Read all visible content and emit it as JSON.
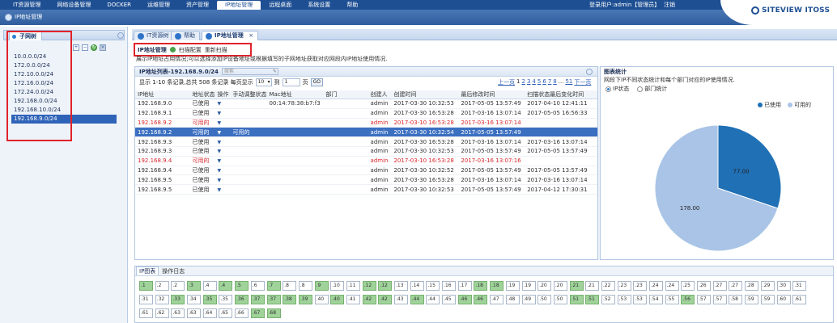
{
  "topnav": {
    "menu": [
      "IT资源管理",
      "网络设备管理",
      "DOCKER",
      "运维管理",
      "资产管理",
      "IP地址管理",
      "远程桌面",
      "系统设置",
      "帮助"
    ],
    "active_index": 5,
    "user_text": "登录用户:admin【管理员】",
    "logout": "注销"
  },
  "banner": {
    "breadcrumb": "IP地址管理",
    "logo_text": "SITEVIEW ITOSS"
  },
  "left": {
    "tab_label": "子网树",
    "tree": [
      "10.0.0.0/24",
      "172.0.0.0/24",
      "172.10.0.0/24",
      "172.16.0.0/24",
      "172.24.0.0/24",
      "192.168.0.0/24",
      "192.168.10.0/24",
      "192.168.9.0/24"
    ],
    "selected_index": 7
  },
  "tabs": [
    {
      "label": "IT资源树"
    },
    {
      "label": "帮助"
    },
    {
      "label": "IP地址管理",
      "close": "×"
    }
  ],
  "toolbar": {
    "title": "IP地址管理",
    "scan": "扫描配置",
    "rescan": "重新扫描"
  },
  "description": "展示IP地址占用情况;可以选择添加IP设备地址或根据填写的子网地址获取对应网段内IP地址使用情况.",
  "list": {
    "title": "IP地址列表-192.168.9.0/24",
    "search_placeholder": "搜索",
    "records": "显示 1-10 条记录,总共 508 条记录 每页显示",
    "page_size": "10",
    "goto_label": "到",
    "page_input": "1",
    "page_suffix": "页",
    "go": "GO",
    "pages": [
      "上一页",
      "1",
      "2",
      "3",
      "4",
      "5",
      "6",
      "7",
      "8",
      "...",
      "51",
      "下一页"
    ],
    "columns": [
      "IP地址",
      "地址状态",
      "操作",
      "手动调整状态",
      "Mac地址",
      "部门",
      "创建人",
      "创建时间",
      "最后修改时间",
      "扫描状态最后变化时间"
    ],
    "rows": [
      {
        "ip": "192.168.9.0",
        "status": "已使用",
        "mark": "▼",
        "manual": "",
        "mac": "00:14:78:38:b7:f3",
        "dept": "",
        "creator": "admin",
        "created": "2017-03-30 10:32:53",
        "modified": "2017-05-05 13:57:49",
        "scan": "2017-04-10 12:41:11",
        "style": "normal"
      },
      {
        "ip": "192.168.9.1",
        "status": "已使用",
        "mark": "▼",
        "manual": "",
        "mac": "",
        "dept": "",
        "creator": "admin",
        "created": "2017-03-30 16:53:28",
        "modified": "2017-03-16 13:07:14",
        "scan": "2017-05-05 16:56:33",
        "style": "normal"
      },
      {
        "ip": "192.168.9.2",
        "status": "可用的",
        "mark": "▼",
        "manual": "",
        "mac": "",
        "dept": "",
        "creator": "admin",
        "created": "2017-03-10 16:53:28",
        "modified": "2017-03-16 13:07:14",
        "scan": "",
        "style": "red"
      },
      {
        "ip": "192.168.9.2",
        "status": "可用的",
        "mark": "▼",
        "manual": "可用的",
        "mac": "",
        "dept": "",
        "creator": "admin",
        "created": "2017-03-30 10:32:54",
        "modified": "2017-05-05 13:57:49",
        "scan": "",
        "style": "selected"
      },
      {
        "ip": "192.168.9.3",
        "status": "已使用",
        "mark": "▼",
        "manual": "",
        "mac": "",
        "dept": "",
        "creator": "admin",
        "created": "2017-03-30 16:53:28",
        "modified": "2017-03-16 13:07:14",
        "scan": "2017-03-16 13:07:14",
        "style": "normal"
      },
      {
        "ip": "192.168.9.3",
        "status": "已使用",
        "mark": "▼",
        "manual": "",
        "mac": "",
        "dept": "",
        "creator": "admin",
        "created": "2017-03-30 10:32:53",
        "modified": "2017-05-05 13:57:49",
        "scan": "2017-05-05 13:57:49",
        "style": "normal"
      },
      {
        "ip": "192.168.9.4",
        "status": "可用的",
        "mark": "▼",
        "manual": "",
        "mac": "",
        "dept": "",
        "creator": "admin",
        "created": "2017-03-10 16:53:28",
        "modified": "2017-03-16 13:07:16",
        "scan": "",
        "style": "red"
      },
      {
        "ip": "192.168.9.4",
        "status": "已使用",
        "mark": "▼",
        "manual": "",
        "mac": "",
        "dept": "",
        "creator": "admin",
        "created": "2017-03-30 10:32:52",
        "modified": "2017-05-05 13:57:49",
        "scan": "2017-05-05 13:57:49",
        "style": "normal"
      },
      {
        "ip": "192.168.9.5",
        "status": "已使用",
        "mark": "▼",
        "manual": "",
        "mac": "",
        "dept": "",
        "creator": "admin",
        "created": "2017-03-30 16:53:28",
        "modified": "2017-03-16 13:07:14",
        "scan": "2017-03-16 13:07:14",
        "style": "normal"
      },
      {
        "ip": "192.168.9.5",
        "status": "已使用",
        "mark": "▼",
        "manual": "",
        "mac": "",
        "dept": "",
        "creator": "admin",
        "created": "2017-03-30 10:32:53",
        "modified": "2017-05-05 13:57:49",
        "scan": "2017-04-12 17:30:31",
        "style": "normal"
      }
    ]
  },
  "chart_panel": {
    "title": "图表统计",
    "desc": "网段下IP不同状态统计和每个部门对应的IP使用情况.",
    "radio_status": "IP状态",
    "radio_dept": "部门统计"
  },
  "chart_data": {
    "type": "pie",
    "title": "",
    "legend_position": "top-right",
    "slices": [
      {
        "name": "已使用",
        "value": 77.0,
        "label": "77.00",
        "color": "#2070b5"
      },
      {
        "name": "可用的",
        "value": 178.0,
        "label": "178.00",
        "color": "#a9c4e6"
      }
    ]
  },
  "bottom": {
    "tabs": [
      "IP图表",
      "操作日志"
    ],
    "active_tab": 0,
    "cells": [
      {
        "n": ".1",
        "u": 1
      },
      {
        "n": ".2",
        "u": 0
      },
      {
        "n": ".2",
        "u": 0
      },
      {
        "n": ".3",
        "u": 1
      },
      {
        "n": ".4",
        "u": 0
      },
      {
        "n": ".4",
        "u": 1
      },
      {
        "n": ".5",
        "u": 1
      },
      {
        "n": ".6",
        "u": 0
      },
      {
        "n": ".7",
        "u": 1
      },
      {
        "n": ".8",
        "u": 0
      },
      {
        "n": ".8",
        "u": 0
      },
      {
        "n": ".9",
        "u": 1
      },
      {
        "n": ".10",
        "u": 0
      },
      {
        "n": ".11",
        "u": 0
      },
      {
        "n": ".12",
        "u": 1
      },
      {
        "n": ".12",
        "u": 1
      },
      {
        "n": ".13",
        "u": 0
      },
      {
        "n": ".14",
        "u": 0
      },
      {
        "n": ".15",
        "u": 0
      },
      {
        "n": ".16",
        "u": 0
      },
      {
        "n": ".17",
        "u": 0
      },
      {
        "n": ".18",
        "u": 1
      },
      {
        "n": ".18",
        "u": 1
      },
      {
        "n": ".19",
        "u": 0
      },
      {
        "n": ".19",
        "u": 0
      },
      {
        "n": ".20",
        "u": 0
      },
      {
        "n": ".20",
        "u": 0
      },
      {
        "n": ".21",
        "u": 1
      },
      {
        "n": ".21",
        "u": 0
      },
      {
        "n": ".22",
        "u": 0
      },
      {
        "n": ".23",
        "u": 0
      },
      {
        "n": ".23",
        "u": 0
      },
      {
        "n": ".24",
        "u": 0
      },
      {
        "n": ".24",
        "u": 0
      },
      {
        "n": ".25",
        "u": 0
      },
      {
        "n": ".26",
        "u": 0
      },
      {
        "n": ".27",
        "u": 0
      },
      {
        "n": ".27",
        "u": 0
      },
      {
        "n": ".28",
        "u": 0
      },
      {
        "n": ".29",
        "u": 0
      },
      {
        "n": ".30",
        "u": 0
      },
      {
        "n": ".31",
        "u": 0
      },
      {
        "n": ".31",
        "u": 0
      },
      {
        "n": ".32",
        "u": 0
      },
      {
        "n": ".33",
        "u": 1
      },
      {
        "n": ".34",
        "u": 0
      },
      {
        "n": ".35",
        "u": 1
      },
      {
        "n": ".35",
        "u": 0
      },
      {
        "n": ".36",
        "u": 1
      },
      {
        "n": ".37",
        "u": 1
      },
      {
        "n": ".37",
        "u": 1
      },
      {
        "n": ".38",
        "u": 1
      },
      {
        "n": ".39",
        "u": 1
      },
      {
        "n": ".40",
        "u": 0
      },
      {
        "n": ".40",
        "u": 1
      },
      {
        "n": ".41",
        "u": 0
      },
      {
        "n": ".42",
        "u": 1
      },
      {
        "n": ".42",
        "u": 1
      },
      {
        "n": ".43",
        "u": 0
      },
      {
        "n": ".44",
        "u": 1
      },
      {
        "n": ".44",
        "u": 0
      },
      {
        "n": ".45",
        "u": 0
      },
      {
        "n": ".46",
        "u": 1
      },
      {
        "n": ".46",
        "u": 1
      },
      {
        "n": ".47",
        "u": 0
      },
      {
        "n": ".48",
        "u": 0
      },
      {
        "n": ".49",
        "u": 0
      },
      {
        "n": ".50",
        "u": 0
      },
      {
        "n": ".50",
        "u": 0
      },
      {
        "n": ".51",
        "u": 1
      },
      {
        "n": ".51",
        "u": 1
      },
      {
        "n": ".52",
        "u": 0
      },
      {
        "n": ".53",
        "u": 0
      },
      {
        "n": ".53",
        "u": 0
      },
      {
        "n": ".54",
        "u": 0
      },
      {
        "n": ".55",
        "u": 0
      },
      {
        "n": ".56",
        "u": 1
      },
      {
        "n": ".57",
        "u": 0
      },
      {
        "n": ".57",
        "u": 0
      },
      {
        "n": ".58",
        "u": 0
      },
      {
        "n": ".59",
        "u": 0
      },
      {
        "n": ".59",
        "u": 0
      },
      {
        "n": ".60",
        "u": 0
      },
      {
        "n": ".61",
        "u": 0
      },
      {
        "n": ".61",
        "u": 0
      },
      {
        "n": ".62",
        "u": 0
      },
      {
        "n": ".63",
        "u": 0
      },
      {
        "n": ".63",
        "u": 0
      },
      {
        "n": ".64",
        "u": 0
      },
      {
        "n": ".65",
        "u": 0
      },
      {
        "n": ".66",
        "u": 0
      },
      {
        "n": ".67",
        "u": 1
      },
      {
        "n": ".68",
        "u": 1
      }
    ]
  }
}
